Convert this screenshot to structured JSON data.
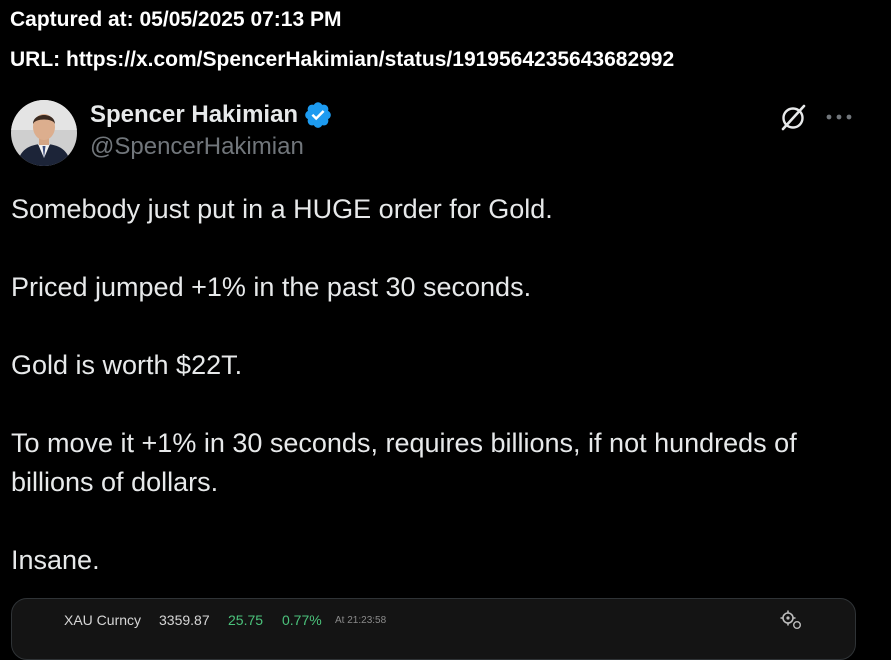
{
  "capture": {
    "captured_at": "Captured at: 05/05/2025 07:13 PM",
    "url": "URL: https://x.com/SpencerHakimian/status/1919564235643682992"
  },
  "tweet": {
    "author": {
      "display_name": "Spencer Hakimian",
      "handle": "@SpencerHakimian",
      "verified": true,
      "verified_color": "#1d9bf0"
    },
    "paragraphs": [
      "Somebody just put in a HUGE order for Gold.",
      "Priced jumped +1% in the past 30 seconds.",
      "Gold is worth $22T.",
      "To move it +1% in 30 seconds, requires billions, if not hundreds of billions of dollars.",
      "Insane."
    ],
    "media": {
      "symbol": "XAU Curncy",
      "price": "3359.87",
      "change": "25.75",
      "change_pct": "0.77%",
      "time": "At 21:23:58",
      "up_color": "#4bc27b"
    },
    "actions": {
      "grok_icon": "grok-icon",
      "more_icon": "more-options-icon"
    }
  }
}
